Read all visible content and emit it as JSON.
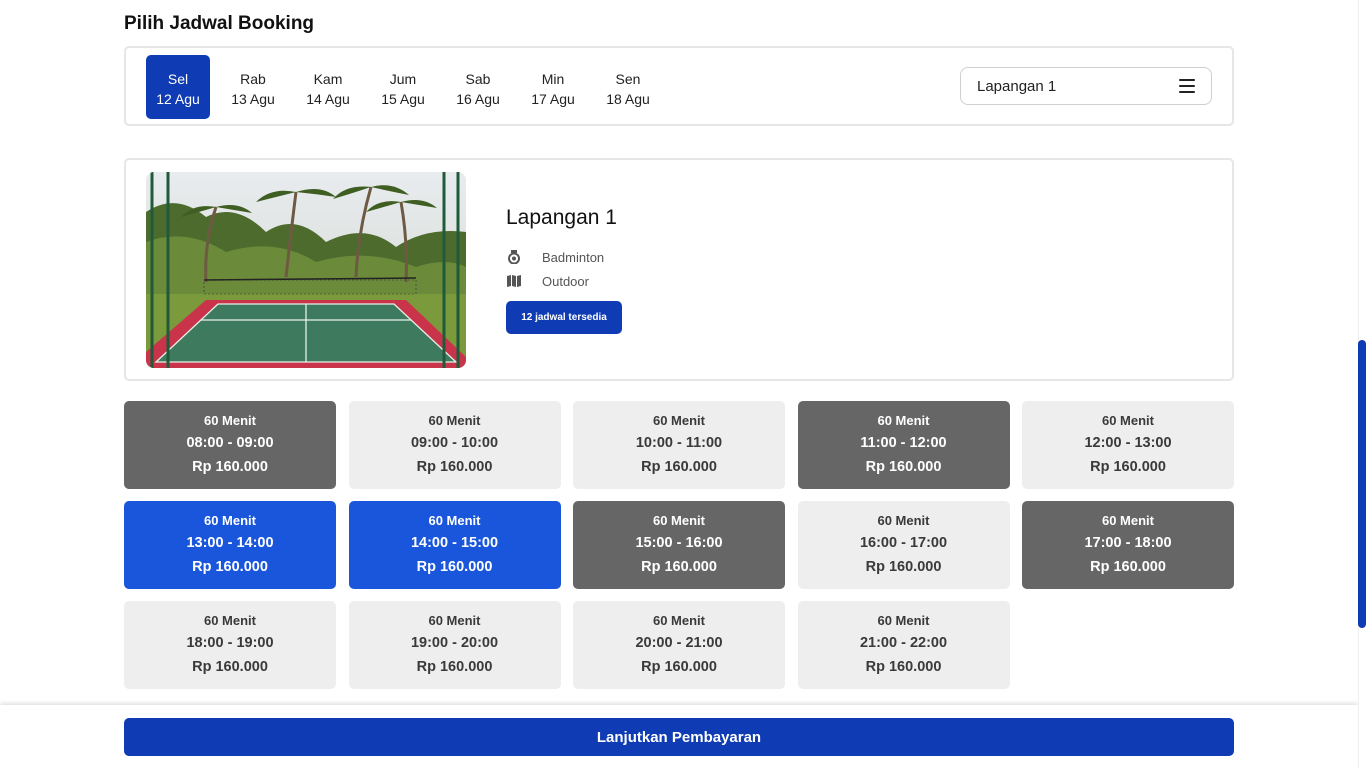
{
  "page": {
    "title": "Pilih Jadwal Booking"
  },
  "dates": [
    {
      "day": "Sel",
      "date": "12 Agu",
      "active": true
    },
    {
      "day": "Rab",
      "date": "13 Agu",
      "active": false
    },
    {
      "day": "Kam",
      "date": "14 Agu",
      "active": false
    },
    {
      "day": "Jum",
      "date": "15 Agu",
      "active": false
    },
    {
      "day": "Sab",
      "date": "16 Agu",
      "active": false
    },
    {
      "day": "Min",
      "date": "17 Agu",
      "active": false
    },
    {
      "day": "Sen",
      "date": "18 Agu",
      "active": false
    }
  ],
  "court_select": {
    "value": "Lapangan 1",
    "icon": "menu-icon"
  },
  "court": {
    "name": "Lapangan 1",
    "sport": "Badminton",
    "sport_icon": "medal-icon",
    "type": "Outdoor",
    "type_icon": "map-icon",
    "availability": "12 jadwal tersedia"
  },
  "slots": [
    {
      "duration": "60 Menit",
      "time": "08:00 - 09:00",
      "price": "Rp 160.000",
      "status": "booked"
    },
    {
      "duration": "60 Menit",
      "time": "09:00 - 10:00",
      "price": "Rp 160.000",
      "status": "available"
    },
    {
      "duration": "60 Menit",
      "time": "10:00 - 11:00",
      "price": "Rp 160.000",
      "status": "available"
    },
    {
      "duration": "60 Menit",
      "time": "11:00 - 12:00",
      "price": "Rp 160.000",
      "status": "booked"
    },
    {
      "duration": "60 Menit",
      "time": "12:00 - 13:00",
      "price": "Rp 160.000",
      "status": "available"
    },
    {
      "duration": "60 Menit",
      "time": "13:00 - 14:00",
      "price": "Rp 160.000",
      "status": "selected"
    },
    {
      "duration": "60 Menit",
      "time": "14:00 - 15:00",
      "price": "Rp 160.000",
      "status": "selected"
    },
    {
      "duration": "60 Menit",
      "time": "15:00 - 16:00",
      "price": "Rp 160.000",
      "status": "booked"
    },
    {
      "duration": "60 Menit",
      "time": "16:00 - 17:00",
      "price": "Rp 160.000",
      "status": "available"
    },
    {
      "duration": "60 Menit",
      "time": "17:00 - 18:00",
      "price": "Rp 160.000",
      "status": "booked"
    },
    {
      "duration": "60 Menit",
      "time": "18:00 - 19:00",
      "price": "Rp 160.000",
      "status": "available"
    },
    {
      "duration": "60 Menit",
      "time": "19:00 - 20:00",
      "price": "Rp 160.000",
      "status": "available"
    },
    {
      "duration": "60 Menit",
      "time": "20:00 - 21:00",
      "price": "Rp 160.000",
      "status": "available"
    },
    {
      "duration": "60 Menit",
      "time": "21:00 - 22:00",
      "price": "Rp 160.000",
      "status": "available"
    }
  ],
  "footer": {
    "pay_label": "Lanjutkan Pembayaran"
  },
  "colors": {
    "primary": "#0f3cb5",
    "selected": "#1a56db",
    "booked": "#666666",
    "available": "#eeeeee"
  }
}
